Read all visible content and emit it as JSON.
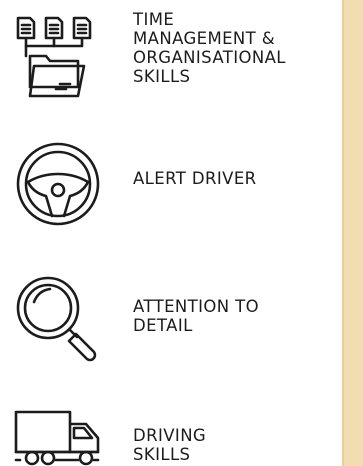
{
  "skills": [
    {
      "label": "TIME\nMANAGEMENT &\nORGANISATIONAL\nSKILLS",
      "icon": "folder-documents-icon"
    },
    {
      "label": "ALERT DRIVER",
      "icon": "steering-wheel-icon"
    },
    {
      "label": "ATTENTION TO\nDETAIL",
      "icon": "magnifying-glass-icon"
    },
    {
      "label": "DRIVING\nSKILLS",
      "icon": "truck-icon"
    }
  ],
  "colors": {
    "text": "#1c1c1c",
    "panel": "#e9cd9a",
    "panel_light": "#f1ddb0"
  }
}
